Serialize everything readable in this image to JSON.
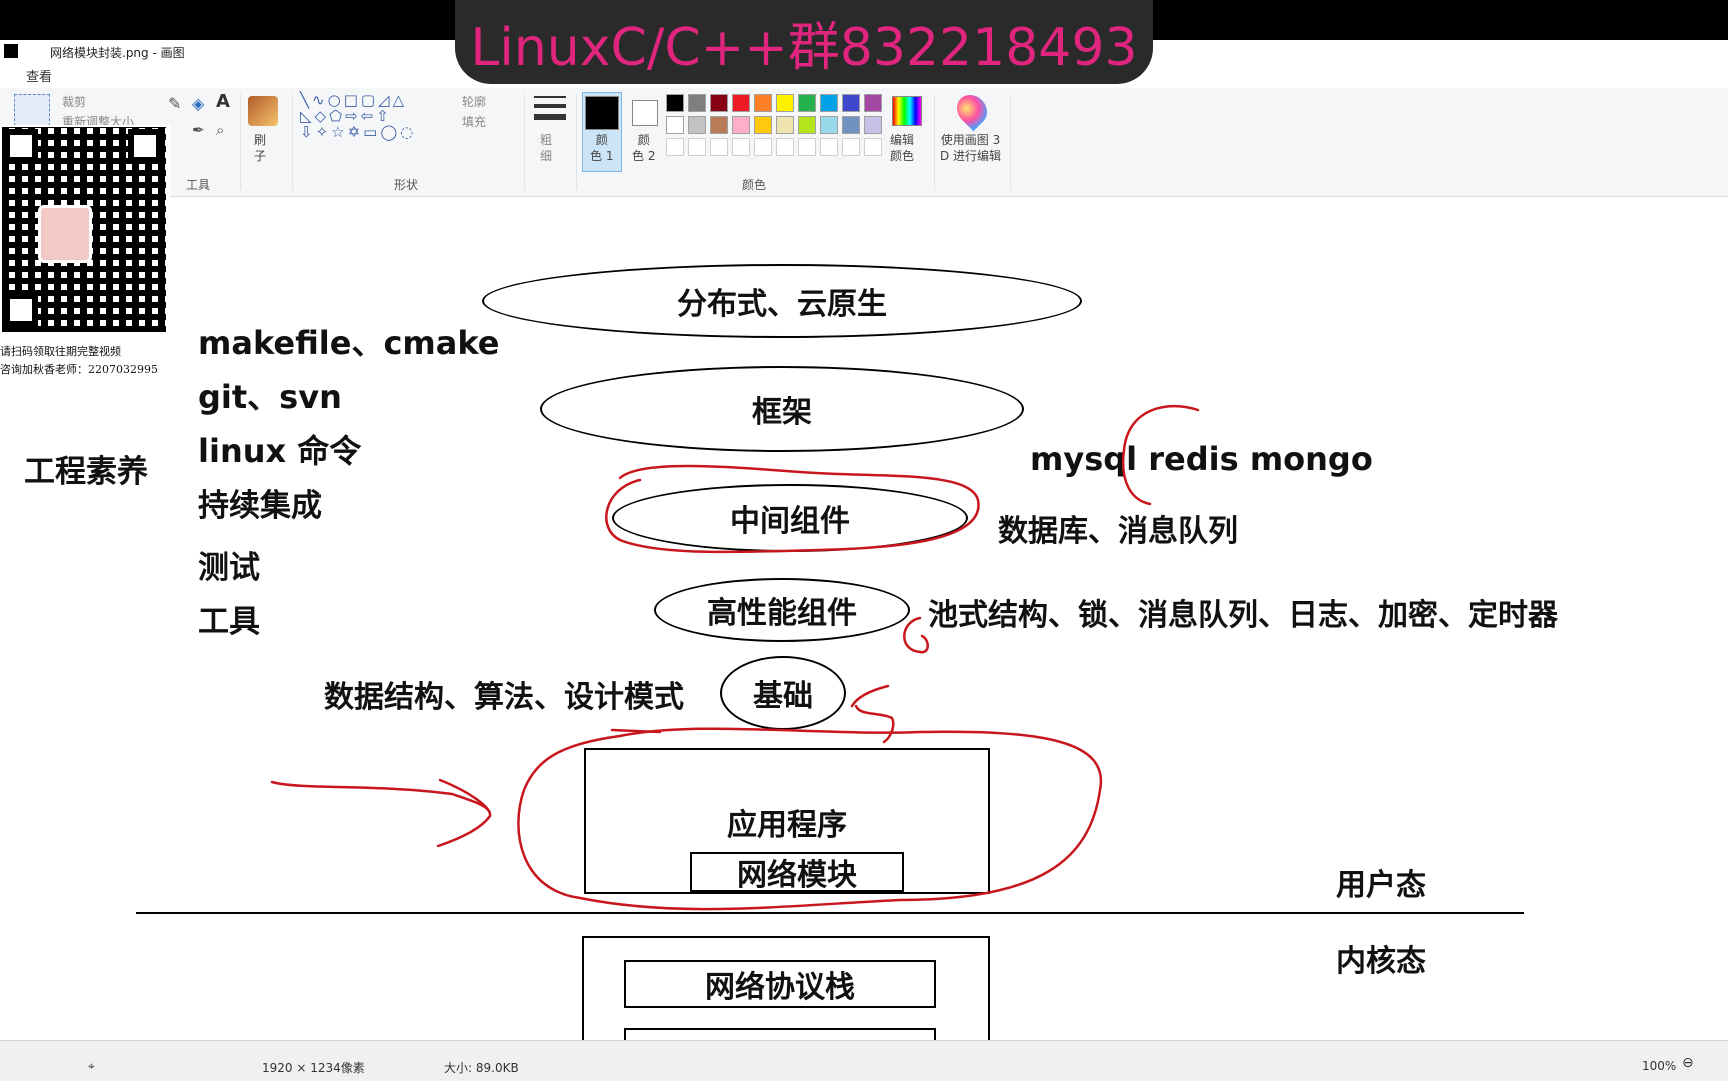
{
  "window": {
    "title": "网络模块封装.png - 画图",
    "menu_view": "查看"
  },
  "overlay": {
    "banner_text": "LinuxC/C++群832218493"
  },
  "ribbon": {
    "image_group": {
      "crop": "裁剪",
      "resize": "重新调整大小"
    },
    "tools_label": "工具",
    "brush_label": "刷\n子",
    "shapes_label": "形状",
    "outline": "轮廓",
    "fill": "填充",
    "size_label": "粗\n细",
    "color1_label": "颜\n色 1",
    "color2_label": "颜\n色 2",
    "colors_label": "颜色",
    "edit_colors": "编辑\n颜色",
    "paint3d": "使用画图 3\nD 进行编辑",
    "palette": [
      "#000000",
      "#7f7f7f",
      "#880015",
      "#ed1c24",
      "#ff7f27",
      "#fff200",
      "#22b14c",
      "#00a2e8",
      "#3f48cc",
      "#a349a4",
      "#ffffff",
      "#c3c3c3",
      "#b97a57",
      "#ffaec9",
      "#ffc90e",
      "#efe4b0",
      "#b5e61d",
      "#99d9ea",
      "#7092be",
      "#c8bfe7"
    ],
    "color1": "#000000",
    "color2": "#ffffff"
  },
  "qr": {
    "caption1": "请扫码领取往期完整视频",
    "caption2": "咨询加秋香老师：2207032995"
  },
  "diagram": {
    "engineering": "工程素养",
    "eng_items": [
      "makefile、cmake",
      "git、svn",
      "linux 命令",
      "持续集成",
      "测试",
      "工具"
    ],
    "layers": {
      "distributed": "分布式、云原生",
      "framework": "框架",
      "middleware": "中间组件",
      "high_perf": "高性能组件",
      "basics": "基础",
      "app": "应用程序",
      "network_module": "网络模块",
      "protocol_stack": "网络协议栈"
    },
    "notes": {
      "dbs": "mysql redis mongo",
      "db_mq": "数据库、消息队列",
      "hp_items": "池式结构、锁、消息队列、日志、加密、定时器",
      "basics_items": "数据结构、算法、设计模式",
      "user_mode": "用户态",
      "kernel_mode": "内核态"
    }
  },
  "status": {
    "dimensions": "1920 × 1234像素",
    "size": "大小: 89.0KB",
    "zoom": "100%"
  }
}
